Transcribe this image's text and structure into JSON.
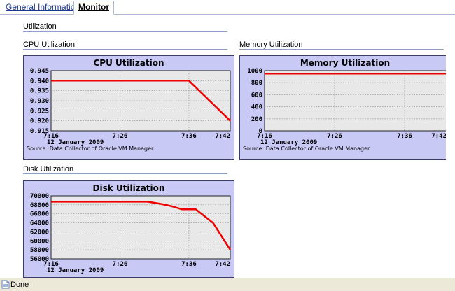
{
  "tabs": [
    {
      "label": "General Information",
      "active": false
    },
    {
      "label": "Monitor",
      "active": true
    }
  ],
  "section_utilization": "Utilization",
  "cpu_section_label": "CPU Utilization",
  "memory_section_label": "Memory Utilization",
  "disk_section_label": "Disk Utilization",
  "colors": {
    "chart_frame": "#c9c9f6",
    "plot_bg": "#e8e8e8",
    "series": "#ee0000"
  },
  "status": {
    "text": "Done",
    "icon": "page-done-icon"
  },
  "chart_data": [
    {
      "id": "cpu",
      "type": "line",
      "title": "CPU Utilization",
      "x_ticks": [
        "7:16",
        "7:26",
        "7:36",
        "7:42"
      ],
      "x_tick_values": [
        0,
        10,
        20,
        26
      ],
      "date_label": "12 January 2009",
      "source": "Source: Data Collector of Oracle VM Manager",
      "y_ticks": [
        "0.945",
        "0.940",
        "0.935",
        "0.930",
        "0.925",
        "0.920",
        "0.915"
      ],
      "y_tick_values": [
        0.945,
        0.94,
        0.935,
        0.93,
        0.925,
        0.92,
        0.915
      ],
      "ylim": [
        0.915,
        0.945
      ],
      "xlim": [
        0,
        26
      ],
      "grid": true,
      "series": [
        {
          "x": [
            0,
            20,
            26
          ],
          "y": [
            0.94,
            0.94,
            0.92
          ]
        }
      ]
    },
    {
      "id": "memory",
      "type": "line",
      "title": "Memory Utilization",
      "x_ticks": [
        "7:16",
        "7:26",
        "7:36",
        "7:42"
      ],
      "x_tick_values": [
        0,
        10,
        20,
        26
      ],
      "date_label": "12 January 2009",
      "source": "Source: Data Collector of Oracle VM Manager",
      "y_ticks": [
        "1000",
        "800",
        "600",
        "400",
        "200",
        "0"
      ],
      "y_tick_values": [
        1000,
        800,
        600,
        400,
        200,
        0
      ],
      "ylim": [
        0,
        1000
      ],
      "xlim": [
        0,
        26
      ],
      "grid": true,
      "series": [
        {
          "x": [
            0,
            26
          ],
          "y": [
            950,
            950
          ]
        }
      ]
    },
    {
      "id": "disk",
      "type": "line",
      "title": "Disk Utilization",
      "x_ticks": [
        "7:16",
        "7:26",
        "7:36",
        "7:42"
      ],
      "x_tick_values": [
        0,
        10,
        20,
        26
      ],
      "date_label": "12 January 2009",
      "source": "",
      "y_ticks": [
        "70000",
        "68000",
        "66000",
        "64000",
        "62000",
        "60000",
        "58000",
        "56000"
      ],
      "y_tick_values": [
        70000,
        68000,
        66000,
        64000,
        62000,
        60000,
        58000,
        56000
      ],
      "ylim": [
        56000,
        70000
      ],
      "xlim": [
        0,
        26
      ],
      "grid": true,
      "series": [
        {
          "x": [
            0,
            14,
            16,
            17.5,
            19,
            21,
            23.5,
            26
          ],
          "y": [
            68700,
            68700,
            68200,
            67700,
            67000,
            67000,
            64000,
            58000
          ]
        }
      ]
    }
  ]
}
